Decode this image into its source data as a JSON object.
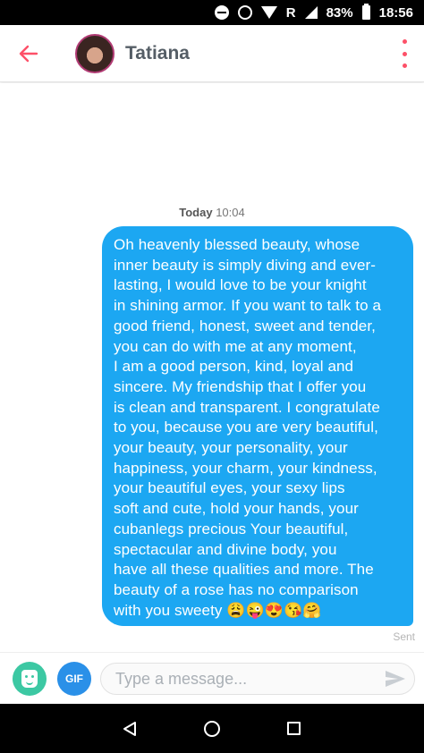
{
  "status_bar": {
    "network_label": "R",
    "battery_percent": "83%",
    "time": "18:56"
  },
  "header": {
    "contact_name": "Tatiana"
  },
  "chat": {
    "timestamp_day": "Today",
    "timestamp_time": "10:04",
    "message_lines": [
      "Oh heavenly blessed beauty, whose",
      "inner beauty is simply diving and ever-",
      "lasting, I would love to be your knight",
      "in shining armor. If you want to talk to a",
      "good friend, honest, sweet and tender,",
      "you can do with me at any moment,",
      "I am a good person, kind, loyal and",
      "sincere. My friendship that I offer you",
      "is clean and transparent. I congratulate",
      "to you, because you are very beautiful,",
      "your beauty, your personality, your",
      "happiness, your charm, your kindness,",
      "your beautiful eyes, your sexy lips",
      "soft and cute, hold your hands, your",
      "cubanlegs precious Your beautiful,",
      "spectacular and divine body, you",
      "have all these qualities and more. The",
      "beauty of a rose has no comparison",
      "with you sweety 😩😜😍😘🤗"
    ],
    "status": "Sent"
  },
  "composer": {
    "gif_label": "GIF",
    "placeholder": "Type a message...",
    "value": ""
  },
  "icons": {
    "back": "arrow-left-icon",
    "menu": "more-vertical-icon",
    "sticker": "sticker-icon",
    "send": "send-icon"
  },
  "colors": {
    "accent": "#fd5068",
    "bubble": "#1ca7f2",
    "sticker_button": "#3cc8a3",
    "gif_button": "#2a90e8"
  }
}
